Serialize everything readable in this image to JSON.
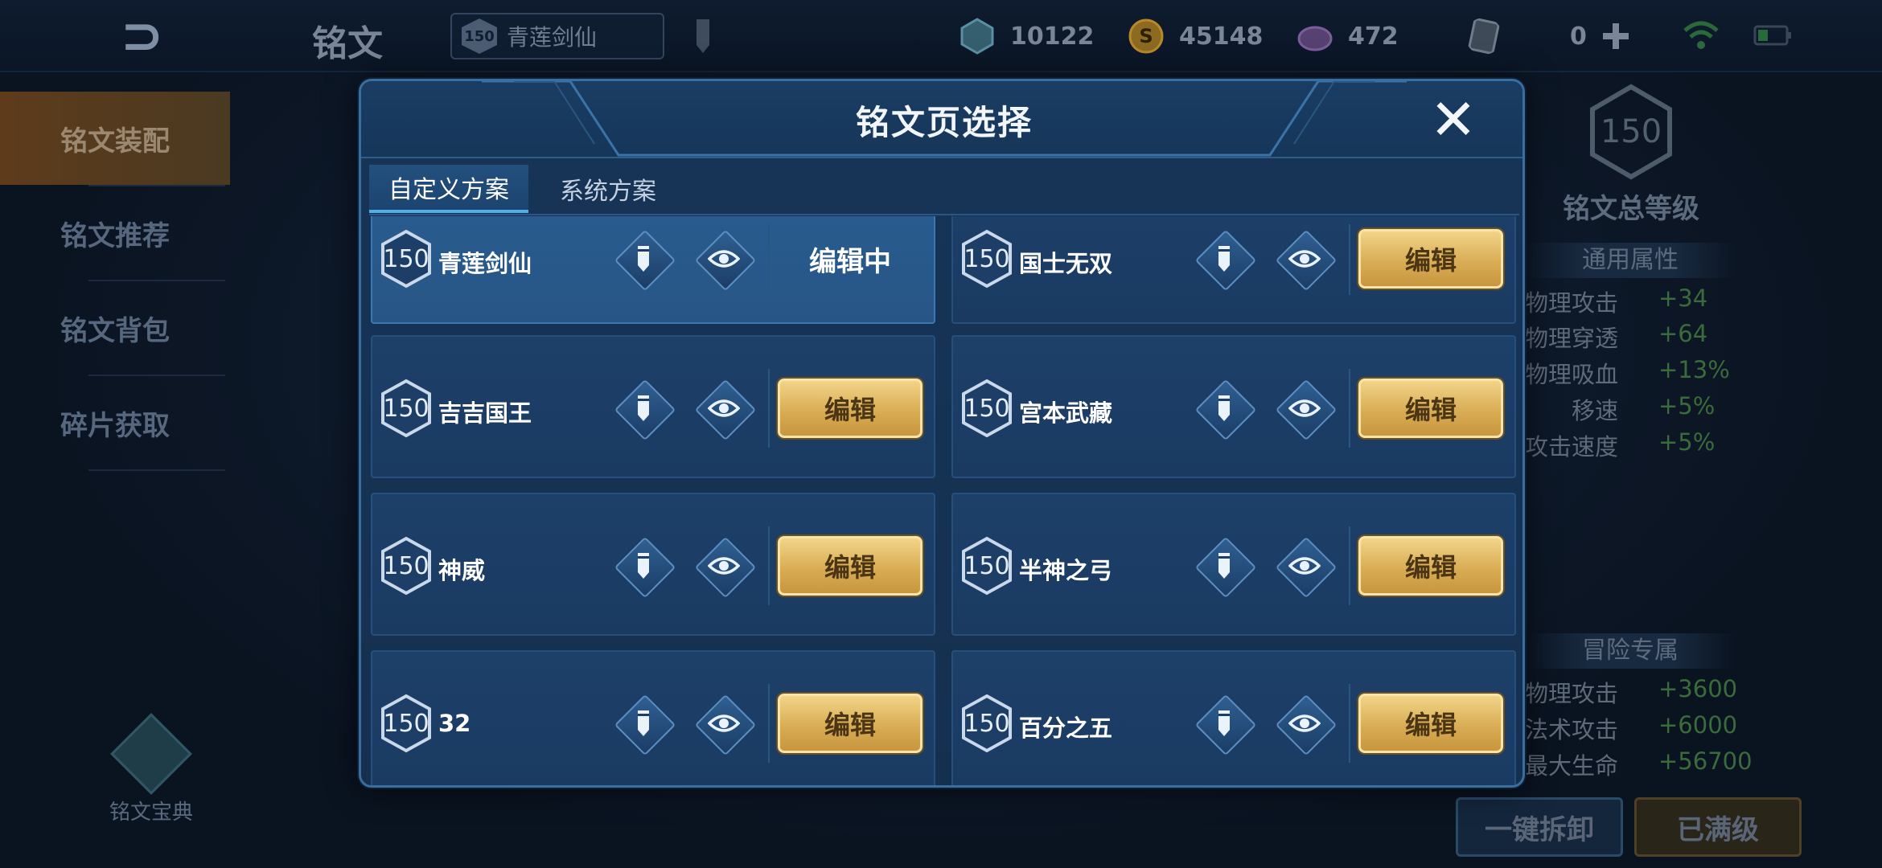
{
  "topbar": {
    "title": "铭文",
    "hero_level": "150",
    "hero_name": "青莲剑仙",
    "resources": [
      {
        "icon": "gem-icon",
        "value": "10122",
        "color": "#5b8fa3"
      },
      {
        "icon": "gold-coin-icon",
        "value": "45148",
        "color": "#b8892a"
      },
      {
        "icon": "crystal-icon",
        "value": "472",
        "color": "#7a5e9a"
      },
      {
        "icon": "card-icon",
        "value": "0",
        "color": "#6f7c8c"
      }
    ]
  },
  "sidebar": {
    "items": [
      {
        "label": "铭文装配"
      },
      {
        "label": "铭文推荐"
      },
      {
        "label": "铭文背包"
      },
      {
        "label": "碎片获取"
      }
    ],
    "book_label": "铭文宝典"
  },
  "right_panel": {
    "level": "150",
    "title": "铭文总等级",
    "general_header": "通用属性",
    "general": [
      {
        "k": "物理攻击",
        "v": "+34"
      },
      {
        "k": "物理穿透",
        "v": "+64"
      },
      {
        "k": "物理吸血",
        "v": "+13%"
      },
      {
        "k": "移速",
        "v": "+5%"
      },
      {
        "k": "攻击速度",
        "v": "+5%"
      }
    ],
    "adventure_header": "冒险专属",
    "adventure": [
      {
        "k": "物理攻击",
        "v": "+3600"
      },
      {
        "k": "法术攻击",
        "v": "+6000"
      },
      {
        "k": "最大生命",
        "v": "+56700"
      }
    ],
    "btn_unequip": "一键拆卸",
    "btn_max": "已满级"
  },
  "modal": {
    "title": "铭文页选择",
    "tabs": [
      {
        "label": "自定义方案"
      },
      {
        "label": "系统方案"
      }
    ],
    "edit_label": "编辑",
    "editing_label": "编辑中",
    "pages": [
      {
        "level": "150",
        "name": "青莲剑仙"
      },
      {
        "level": "150",
        "name": "国士无双"
      },
      {
        "level": "150",
        "name": "吉吉国王"
      },
      {
        "level": "150",
        "name": "宫本武藏"
      },
      {
        "level": "150",
        "name": "神威"
      },
      {
        "level": "150",
        "name": "半神之弓"
      },
      {
        "level": "150",
        "name": "32"
      },
      {
        "level": "150",
        "name": "百分之五"
      }
    ]
  }
}
